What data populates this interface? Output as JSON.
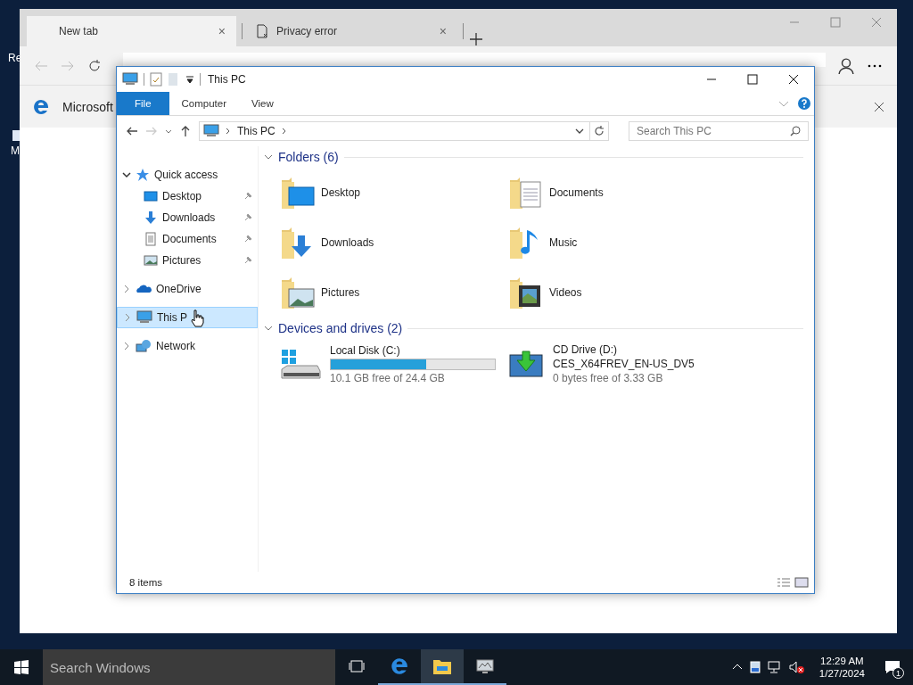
{
  "desktop": {
    "icons": [
      {
        "label": "Re"
      },
      {
        "label": "M"
      }
    ]
  },
  "browser": {
    "tabs": [
      {
        "label": "New tab",
        "close": "×",
        "selected": true
      },
      {
        "label": "Privacy error",
        "close": "×",
        "selected": false
      }
    ],
    "infobar": {
      "text": "Microsoft"
    }
  },
  "explorer": {
    "title": "This PC",
    "ribbon_tabs": [
      {
        "label": "File",
        "selected": true
      },
      {
        "label": "Computer",
        "selected": false
      },
      {
        "label": "View",
        "selected": false
      }
    ],
    "breadcrumb": [
      "This PC"
    ],
    "search": {
      "placeholder": "Search This PC"
    },
    "nav": [
      {
        "label": "Quick access",
        "kind": "star",
        "expanded": true,
        "selected": false,
        "children": [
          {
            "label": "Desktop",
            "kind": "desktop",
            "pinned": true
          },
          {
            "label": "Downloads",
            "kind": "downloads",
            "pinned": true
          },
          {
            "label": "Documents",
            "kind": "documents",
            "pinned": true
          },
          {
            "label": "Pictures",
            "kind": "pictures",
            "pinned": true
          }
        ]
      },
      {
        "label": "OneDrive",
        "kind": "cloud",
        "expanded": false,
        "selected": false
      },
      {
        "label": "This P",
        "kind": "pc",
        "expanded": false,
        "selected": true
      },
      {
        "label": "Network",
        "kind": "network",
        "expanded": false,
        "selected": false
      }
    ],
    "sections": [
      {
        "title": "Folders (6)",
        "kind": "folders",
        "expanded": true,
        "items": [
          {
            "name": "Desktop",
            "kind": "desktop"
          },
          {
            "name": "Documents",
            "kind": "documents"
          },
          {
            "name": "Downloads",
            "kind": "downloads"
          },
          {
            "name": "Music",
            "kind": "music"
          },
          {
            "name": "Pictures",
            "kind": "pictures"
          },
          {
            "name": "Videos",
            "kind": "videos"
          }
        ]
      },
      {
        "title": "Devices and drives (2)",
        "kind": "drives",
        "expanded": true,
        "items": [
          {
            "name": "Local Disk (C:)",
            "kind": "disk",
            "level": 0.58,
            "detail": "10.1 GB free of 24.4 GB"
          },
          {
            "name": "CD Drive (D:)",
            "kind": "cd",
            "volume": "CES_X64FREV_EN-US_DV5",
            "detail": "0 bytes free of 3.33 GB"
          }
        ]
      }
    ],
    "status": "8 items"
  },
  "taskbar": {
    "search_placeholder": "Search Windows",
    "apps": [
      {
        "kind": "edge",
        "active": false
      },
      {
        "kind": "explorer",
        "active": true
      },
      {
        "kind": "monitor",
        "active": false
      }
    ],
    "time": "12:29 AM",
    "date": "1/27/2024",
    "notifications": "1"
  }
}
